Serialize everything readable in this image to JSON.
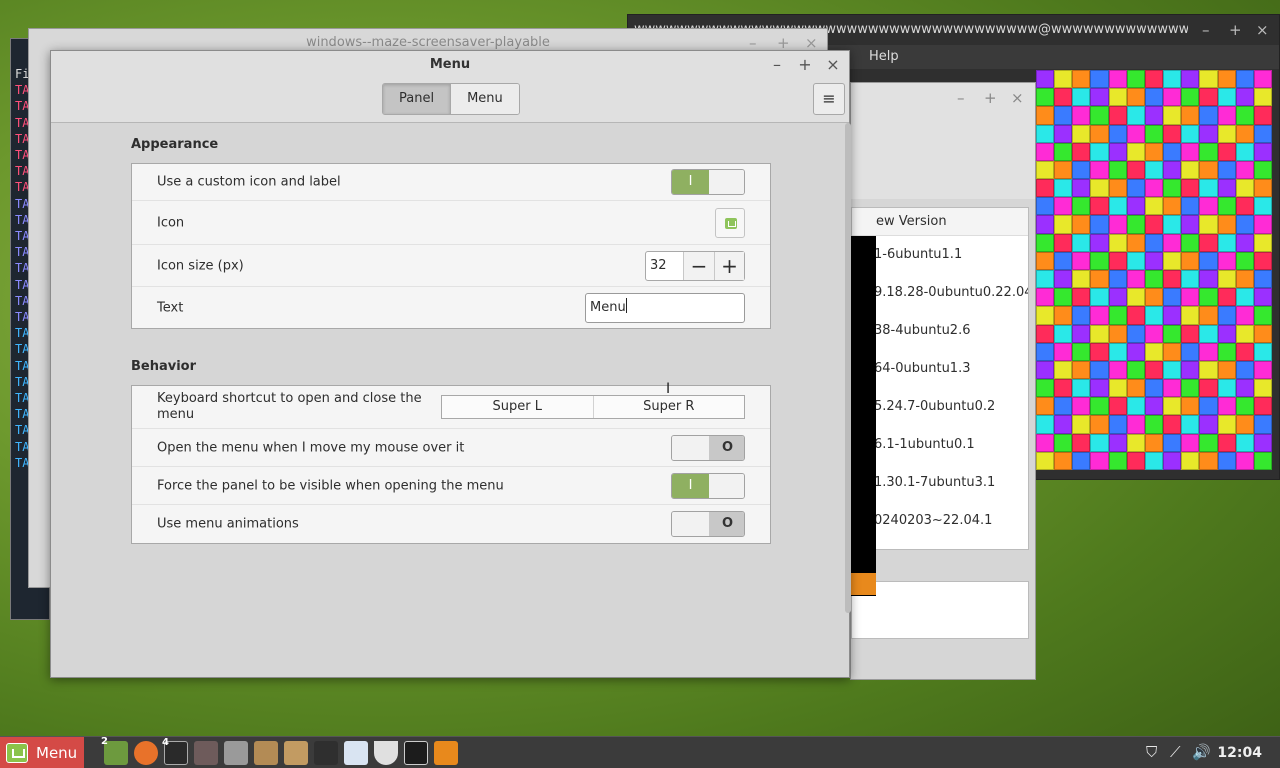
{
  "background": {
    "terminal_lines": [
      "Fil",
      "TAK",
      "TAK",
      "TAK",
      "TAK",
      "TAK",
      "TAK",
      "TAK",
      "TAK",
      "TAK",
      "TAK",
      "TAK",
      "TAK",
      "TAK",
      "TAK",
      "TAK",
      "TAK",
      "TAK",
      "TAK",
      "TAK",
      "TAK",
      "TAK",
      "TAK",
      "TAK",
      "TAKE"
    ],
    "terminal_title": "wwwwwwwwwwwwwwwwwwwwwwwwwwwwwwwwwwwwww@wwwwwwwwwwwwwwwwwwwwwwwwwwwwwwwww",
    "terminal_menu_help": "Help",
    "maze_window_title": "windows--maze-screensaver-playable",
    "update_manager": {
      "column_header": "ew Version",
      "versions": [
        "1-6ubuntu1.1",
        "9.18.28-0ubuntu0.22.04.",
        "38-4ubuntu2.6",
        "64-0ubuntu1.3",
        "5.24.7-0ubuntu0.2",
        "6.1-1ubuntu0.1",
        "1.30.1-7ubuntu3.1",
        "0240203~22.04.1"
      ]
    },
    "maze_colors": [
      "#ff2bd6",
      "#35e82e",
      "#ff8c1a",
      "#3a7bff",
      "#9b30ff",
      "#e8e82a",
      "#ff2b5a",
      "#2ae8e8"
    ]
  },
  "dialog": {
    "title": "Menu",
    "controls": {
      "minimize": "–",
      "maximize": "+",
      "close": "×"
    },
    "tabs": [
      {
        "label": "Panel",
        "active": true
      },
      {
        "label": "Menu",
        "active": false
      }
    ],
    "hamburger": "≡",
    "appearance": {
      "title": "Appearance",
      "custom_icon_label": "Use a custom icon and label",
      "custom_icon_on": true,
      "icon_label": "Icon",
      "icon_size_label": "Icon size (px)",
      "icon_size_value": "32",
      "minus": "−",
      "plus": "+",
      "text_label": "Text",
      "text_value": "Menu"
    },
    "behavior": {
      "title": "Behavior",
      "shortcut_label": "Keyboard shortcut to open and close the menu",
      "shortcut_1": "Super L",
      "shortcut_2": "Super R",
      "hover_label": "Open the menu when I move my mouse over it",
      "hover_on": false,
      "force_visible_label": "Force the panel to be visible when opening the menu",
      "force_visible_on": true,
      "animations_label": "Use menu animations",
      "animations_on": false
    },
    "switch_on_symbol": "I",
    "switch_off_symbol": "O"
  },
  "taskbar": {
    "menu_label": "Menu",
    "badge_1": "2",
    "badge_2": "4",
    "clock": "12:04"
  }
}
